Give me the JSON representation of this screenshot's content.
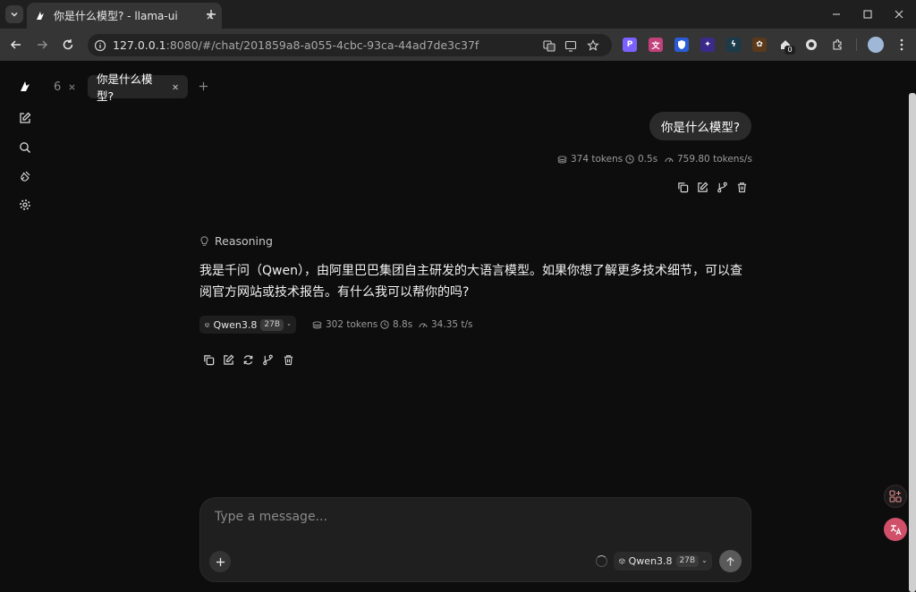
{
  "browser": {
    "tab_title": "你是什么模型? - llama-ui",
    "url_host": "127.0.0.1",
    "url_rest": ":8080/#/chat/201859a8-a055-4cbc-93ca-44ad7de3c37f",
    "ext_count": "0"
  },
  "chat_tabs": [
    {
      "label": "6"
    },
    {
      "label": "你是什么模型?"
    }
  ],
  "user_message": {
    "text": "你是什么模型?",
    "tokens": "374 tokens",
    "time": "0.5s",
    "speed": "759.80 tokens/s"
  },
  "assistant_message": {
    "reasoning_label": "Reasoning",
    "text": "我是千问（Qwen），由阿里巴巴集团自主研发的大语言模型。如果你想了解更多技术细节，可以查阅官方网站或技术报告。有什么我可以帮你的吗?",
    "model": "Qwen3.8",
    "model_badge": "27B",
    "tokens": "302 tokens",
    "time": "8.8s",
    "speed": "34.35 t/s"
  },
  "composer": {
    "placeholder": "Type a message...",
    "model": "Qwen3.8",
    "model_badge": "27B"
  },
  "colors": {
    "background": "#0d0d0d",
    "bubble": "#2b2b2b",
    "chrome_toolbar": "#353535"
  }
}
